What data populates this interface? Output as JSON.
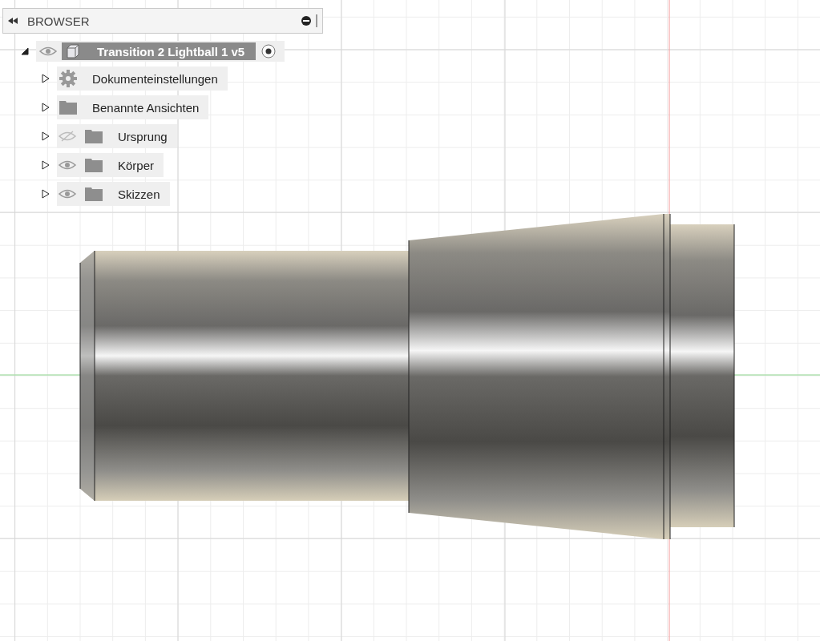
{
  "browser": {
    "title": "BROWSER",
    "root": {
      "label": "Transition 2 Lightball 1 v5",
      "expanded": true,
      "visible": true,
      "active": true,
      "children": [
        {
          "label": "Dokumenteinstellungen",
          "kind": "settings",
          "expanded": false
        },
        {
          "label": "Benannte Ansichten",
          "kind": "folder",
          "expanded": false
        },
        {
          "label": "Ursprung",
          "kind": "folder",
          "expanded": false,
          "visible": false
        },
        {
          "label": "Körper",
          "kind": "folder",
          "expanded": false,
          "visible": true
        },
        {
          "label": "Skizzen",
          "kind": "folder",
          "expanded": false,
          "visible": true
        }
      ]
    }
  }
}
